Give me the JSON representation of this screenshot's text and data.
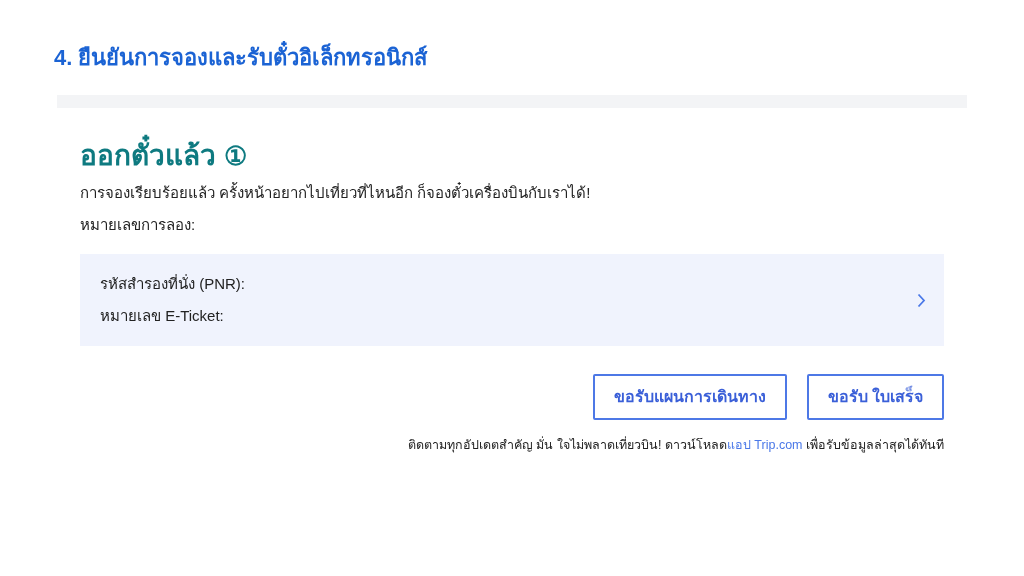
{
  "section_heading": "4. ยืนยันการจองและรับตั๋วอิเล็กทรอนิกส์",
  "status": {
    "title": "ออกตั๋วแล้ว",
    "step_mark": "①"
  },
  "message": "การจองเรียบร้อยแล้ว ครั้งหน้าอยากไปเที่ยวที่ไหนอีก ก็จองตั๋วเครื่องบินกับเราได้!",
  "booking_number_label": "หมายเลขการลอง:",
  "ticket_info": {
    "lines": [
      "รหัสสำรองที่นั่ง (PNR):",
      "หมายเลข E-Ticket:"
    ]
  },
  "buttons": [
    "ขอรับแผนการเดินทาง",
    "ขอรับ ใบเสร็จ"
  ],
  "footer": {
    "before": "ติดตามทุกอัปเดตสำคัญ มั่น ใจไม่พลาดเที่ยวบิน! ดาวน์โหลด",
    "link": "แอป Trip.com",
    "after": " เพื่อรับข้อมูลล่าสุดได้ทันที"
  }
}
